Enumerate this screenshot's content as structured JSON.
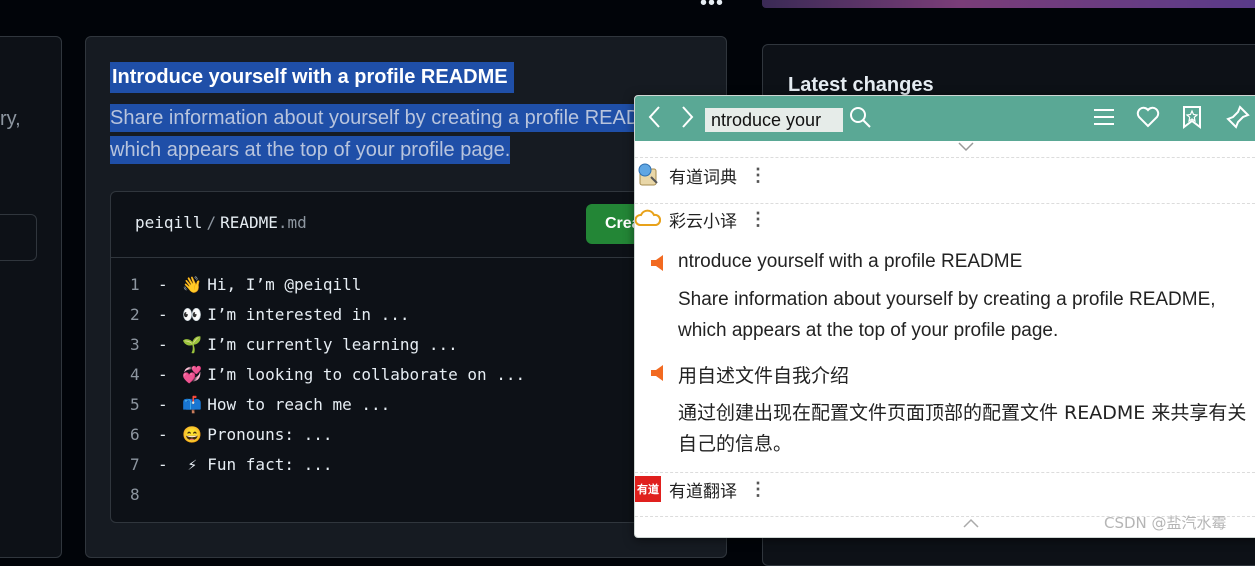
{
  "top": {
    "more_label": "•••"
  },
  "left_card": {
    "partial_text": "ry,"
  },
  "profile_readme": {
    "title": "Introduce yourself with a profile README",
    "description_line1": "Share information about yourself by creating a profile README,",
    "description_line2": "which appears at the top of your profile page.",
    "path_user": "peiqill",
    "path_sep": "/",
    "path_file": "README",
    "path_ext": ".md",
    "create_button": "Create",
    "lines": [
      {
        "num": "1",
        "emoji": "👋",
        "text": "Hi, I’m @peiqill"
      },
      {
        "num": "2",
        "emoji": "👀",
        "text": "I’m interested in ..."
      },
      {
        "num": "3",
        "emoji": "🌱",
        "text": "I’m currently learning ..."
      },
      {
        "num": "4",
        "emoji": "💞️",
        "text": "I’m looking to collaborate on ..."
      },
      {
        "num": "5",
        "emoji": "📫",
        "text": "How to reach me ..."
      },
      {
        "num": "6",
        "emoji": "😄",
        "text": "Pronouns: ..."
      },
      {
        "num": "7",
        "emoji": "⚡",
        "text": "Fun fact: ..."
      },
      {
        "num": "8",
        "emoji": "",
        "text": ""
      }
    ]
  },
  "right_card": {
    "title": "Latest changes"
  },
  "youdao_popup": {
    "search_value": "ntroduce your",
    "sources": {
      "dict": "有道词典",
      "caiyun": "彩云小译",
      "fanyi": "有道翻译"
    },
    "english_title": "ntroduce yourself with a profile README",
    "english_line1": "Share information about yourself by creating a profile README,",
    "english_line2": "which appears at the top of your profile page.",
    "chinese_title": "用自述文件自我介绍",
    "chinese_line1": "通过创建出现在配置文件页面顶部的配置文件 README 来共享有关",
    "chinese_line2": "自己的信息。",
    "fanyi_logo": "有道"
  },
  "watermark": "CSDN @盐汽水霉",
  "colors": {
    "github_bg": "#010409",
    "card_bg": "#161b22",
    "selection": "#1f4fa8",
    "create_green": "#238636",
    "popup_header": "#5aa895",
    "speaker_orange": "#f26a21"
  }
}
